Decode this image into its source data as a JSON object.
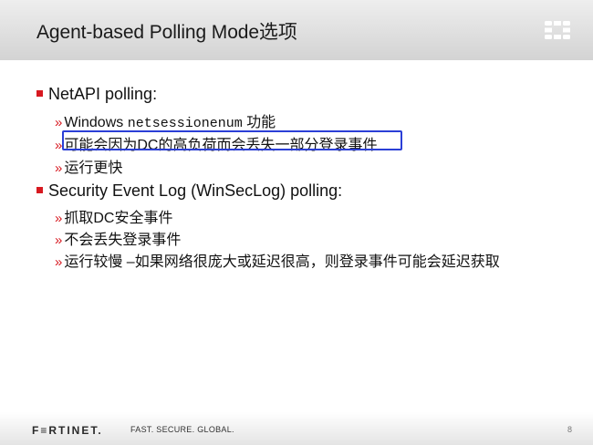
{
  "header": {
    "title": "Agent-based Polling Mode选项"
  },
  "items": [
    {
      "label": "NetAPI polling:",
      "subitems": [
        {
          "prefix": "Windows ",
          "code": "netsessionenum",
          "suffix": " 功能"
        },
        {
          "text": "可能会因为DC的高负荷而会丢失一部分登录事件"
        },
        {
          "text": "运行更快"
        }
      ]
    },
    {
      "label": "Security Event Log (WinSecLog) polling:",
      "subitems": [
        {
          "text": "抓取DC安全事件"
        },
        {
          "text": "不会丢失登录事件"
        },
        {
          "text": "运行较慢 –如果网络很庞大或延迟很高，则登录事件可能会延迟获取"
        }
      ]
    }
  ],
  "footer": {
    "brand": "F≡RTINET.",
    "tagline": "FAST. SECURE. GLOBAL.",
    "page_number": "8"
  },
  "colors": {
    "accent_red": "#d71920",
    "highlight_blue": "#2b3fd6",
    "header_bg": "#d8d8d8"
  },
  "icons": {
    "bullet_level1": "red-square",
    "bullet_level2": "double-chevron",
    "logo": "fortinet-grid-logo"
  }
}
